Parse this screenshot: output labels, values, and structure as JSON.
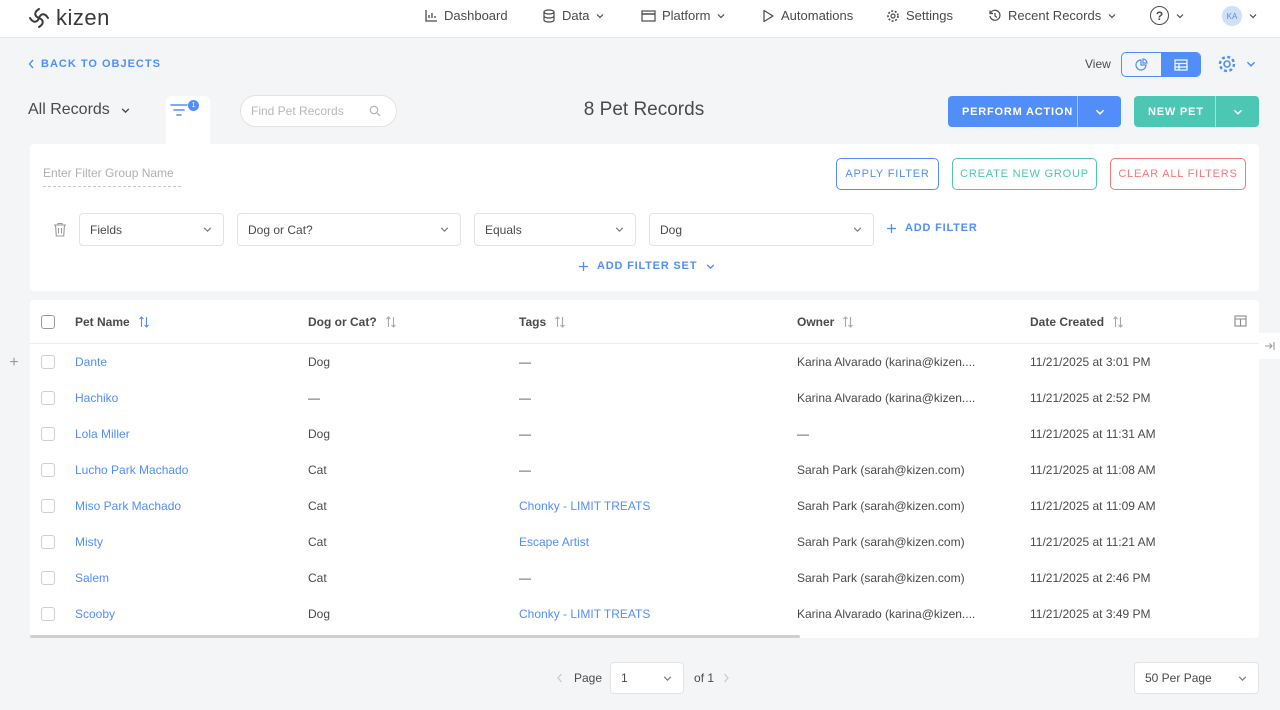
{
  "app": {
    "brand": "kizen",
    "accent": "#528ef9",
    "teal": "#4bc7b4",
    "danger": "#f47979"
  },
  "nav": {
    "dashboard": "Dashboard",
    "data": "Data",
    "platform": "Platform",
    "automations": "Automations",
    "settings": "Settings",
    "recent_records": "Recent Records",
    "help": "?",
    "avatar": "KA"
  },
  "toolbar": {
    "back": "BACK TO OBJECTS",
    "view_label": "View",
    "all_records": "All Records",
    "filter_badge": "1",
    "search_placeholder": "Find Pet Records",
    "record_count": "8 Pet Records",
    "perform_action": "PERFORM ACTION",
    "new_pet": "NEW PET"
  },
  "filter": {
    "group_name_placeholder": "Enter Filter Group Name",
    "apply": "APPLY FILTER",
    "create_group": "CREATE NEW GROUP",
    "clear_all": "CLEAR ALL FILTERS",
    "field_type": "Fields",
    "field": "Dog or Cat?",
    "operator": "Equals",
    "value": "Dog",
    "add_filter": "ADD FILTER",
    "add_filter_set": "ADD FILTER SET"
  },
  "table": {
    "columns": [
      "Pet Name",
      "Dog or Cat?",
      "Tags",
      "Owner",
      "Date Created"
    ],
    "rows": [
      {
        "name": "Dante",
        "type": "Dog",
        "tags": "—",
        "owner": "Karina Alvarado (karina@kizen....",
        "date": "11/21/2025  at 3:01 PM"
      },
      {
        "name": "Hachiko",
        "type": "—",
        "tags": "—",
        "owner": "Karina Alvarado (karina@kizen....",
        "date": "11/21/2025  at 2:52 PM"
      },
      {
        "name": "Lola Miller",
        "type": "Dog",
        "tags": "—",
        "owner": "—",
        "date": "11/21/2025  at 11:31 AM"
      },
      {
        "name": "Lucho Park Machado",
        "type": "Cat",
        "tags": "—",
        "owner": "Sarah Park (sarah@kizen.com)",
        "date": "11/21/2025  at 11:08 AM"
      },
      {
        "name": "Miso Park Machado",
        "type": "Cat",
        "tags": "Chonky - LIMIT TREATS",
        "owner": "Sarah Park (sarah@kizen.com)",
        "date": "11/21/2025  at 11:09 AM"
      },
      {
        "name": "Misty",
        "type": "Cat",
        "tags": "Escape Artist",
        "owner": "Sarah Park (sarah@kizen.com)",
        "date": "11/21/2025  at 11:21 AM"
      },
      {
        "name": "Salem",
        "type": "Cat",
        "tags": "—",
        "owner": "Sarah Park (sarah@kizen.com)",
        "date": "11/21/2025  at 2:46 PM"
      },
      {
        "name": "Scooby",
        "type": "Dog",
        "tags": "Chonky - LIMIT TREATS",
        "owner": "Karina Alvarado (karina@kizen....",
        "date": "11/21/2025  at 3:49 PM"
      }
    ]
  },
  "pagination": {
    "page_label": "Page",
    "page": "1",
    "of": "of 1",
    "per_page": "50 Per Page"
  }
}
